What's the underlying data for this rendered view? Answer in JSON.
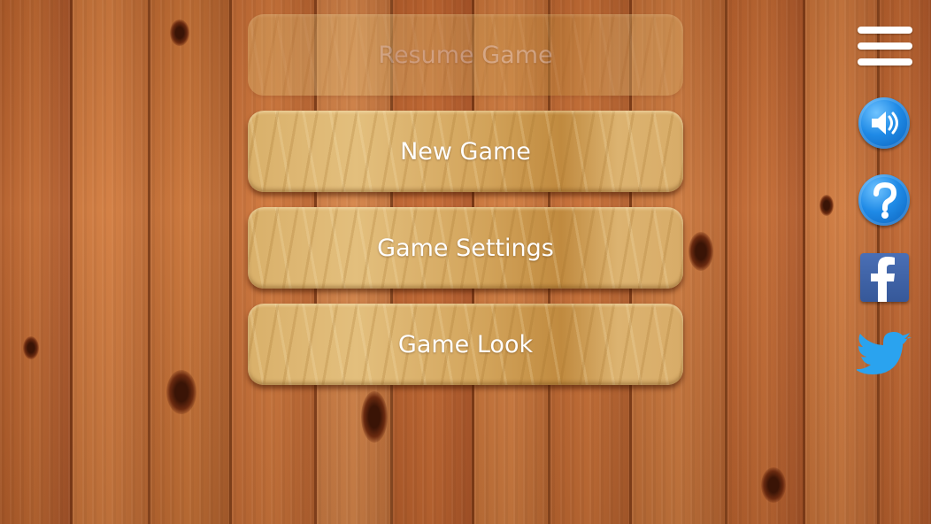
{
  "menu": {
    "resume_label": "Resume Game",
    "new_game_label": "New Game",
    "settings_label": "Game Settings",
    "look_label": "Game Look"
  },
  "icons": {
    "menu": "hamburger-menu-icon",
    "sound": "speaker-icon",
    "help": "question-mark-icon",
    "facebook": "facebook-icon",
    "twitter": "twitter-bird-icon"
  },
  "colors": {
    "wood_background": "#b8642e",
    "button_wood": "#d9b06a",
    "icon_blue": "#1f8ae6",
    "facebook_blue": "#3b5998",
    "twitter_blue": "#2aa3ef"
  }
}
